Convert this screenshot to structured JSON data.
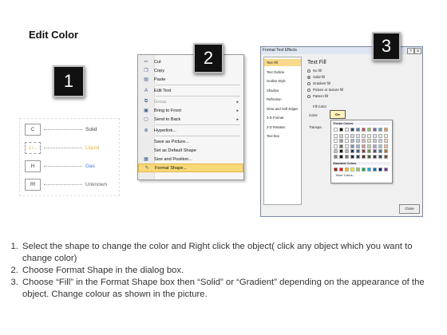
{
  "title": "Edit Color",
  "steps": [
    "1",
    "2",
    "3"
  ],
  "diagram": {
    "rows": [
      {
        "box": "C",
        "label": "Solid",
        "color": "#444444"
      },
      {
        "box": "Li...",
        "label": "Liquid",
        "color": "#e8b43a"
      },
      {
        "box": "H",
        "label": "Gas",
        "color": "#3a7ed8"
      },
      {
        "box": "Rf",
        "label": "Unknown",
        "color": "#666666"
      }
    ]
  },
  "context_menu": {
    "items": [
      {
        "icon": "scissors-icon",
        "glyph": "✂",
        "label": "Cut",
        "state": "normal"
      },
      {
        "icon": "copy-icon",
        "glyph": "❐",
        "label": "Copy",
        "state": "normal"
      },
      {
        "icon": "paste-icon",
        "glyph": "▤",
        "label": "Paste",
        "state": "normal"
      },
      {
        "sep": true
      },
      {
        "icon": "edit-text-icon",
        "glyph": "A",
        "label": "Edit Text",
        "state": "normal"
      },
      {
        "sep": true
      },
      {
        "icon": "group-icon",
        "glyph": "⧉",
        "label": "Group",
        "state": "disabled",
        "arrow": "▸"
      },
      {
        "icon": "bring-front-icon",
        "glyph": "▣",
        "label": "Bring to Front",
        "state": "normal",
        "arrow": "▸"
      },
      {
        "icon": "send-back-icon",
        "glyph": "▢",
        "label": "Send to Back",
        "state": "normal",
        "arrow": "▸"
      },
      {
        "sep": true
      },
      {
        "icon": "hyperlink-icon",
        "glyph": "⊕",
        "label": "Hyperlink...",
        "state": "normal"
      },
      {
        "sep": true
      },
      {
        "icon": "",
        "glyph": "",
        "label": "Save as Picture...",
        "state": "normal"
      },
      {
        "icon": "",
        "glyph": "",
        "label": "Set as Default Shape",
        "state": "normal"
      },
      {
        "icon": "size-position-icon",
        "glyph": "▦",
        "label": "Size and Position...",
        "state": "normal"
      },
      {
        "icon": "format-shape-icon",
        "glyph": "✎",
        "label": "Format Shape...",
        "state": "highlight"
      }
    ]
  },
  "dialog": {
    "title": "Format Text Effects",
    "title_buttons": [
      "?",
      "X"
    ],
    "sidebar": [
      "Text Fill",
      "Text Outline",
      "Outline Style",
      "Shadow",
      "Reflection",
      "Glow and Soft Edges",
      "3-D Format",
      "3-D Rotation",
      "Text Box"
    ],
    "selected_index": 0,
    "heading": "Text Fill",
    "options": [
      {
        "label": "No fill",
        "checked": false
      },
      {
        "label": "Solid fill",
        "checked": true
      },
      {
        "label": "Gradient fill",
        "checked": false
      },
      {
        "label": "Picture or texture fill",
        "checked": false
      },
      {
        "label": "Pattern fill",
        "checked": false
      }
    ],
    "fill_color_label": "Fill Color",
    "color_label": "Color:",
    "transparency_label": "Transpa",
    "theme_colors_label": "Theme Colors",
    "standard_colors_label": "Standard Colors",
    "more_colors_label": "More Colors...",
    "close_label": "Close",
    "theme_top": [
      "#ffffff",
      "#000000",
      "#eeece1",
      "#1f497d",
      "#4f81bd",
      "#c0504d",
      "#9bbb59",
      "#8064a2",
      "#4bacc6",
      "#f79646"
    ],
    "standard": [
      "#c00000",
      "#ff0000",
      "#ffc000",
      "#ffff00",
      "#92d050",
      "#00b050",
      "#00b0f0",
      "#0070c0",
      "#002060",
      "#7030a0"
    ]
  },
  "instructions": [
    "Select the shape to change the color and Right click the object( click any object which you want to change color)",
    "Choose Format Shape in the dialog box.",
    "Choose “Fill” in the Format Shape box then “Solid” or “Gradient” depending on the appearance of the object. Change colour as shown in the picture."
  ]
}
